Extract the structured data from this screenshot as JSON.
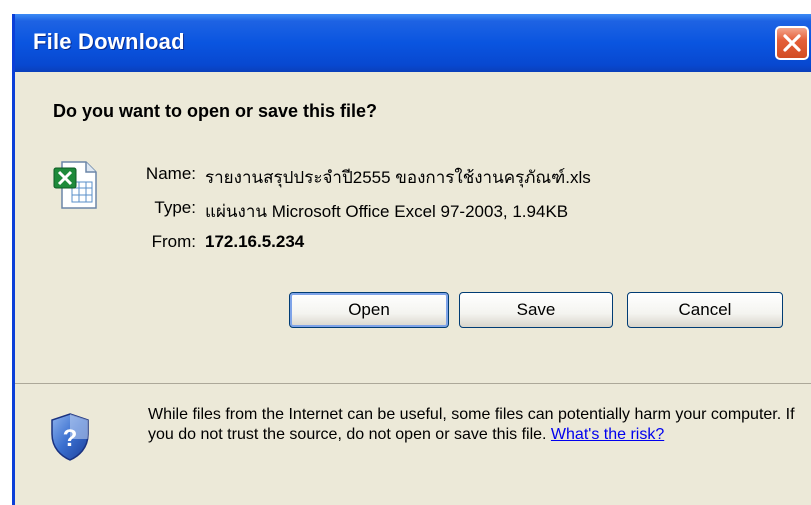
{
  "window": {
    "title": "File Download"
  },
  "prompt": {
    "question": "Do you want to open or save this file?"
  },
  "file": {
    "icon": "excel-file-icon",
    "name_label": "Name:",
    "name_value": "รายงานสรุปประจำปี2555 ของการใช้งานครุภัณฑ์.xls",
    "type_label": "Type:",
    "type_value": "แผ่นงาน Microsoft Office Excel 97-2003, 1.94KB",
    "from_label": "From:",
    "from_value": "172.16.5.234"
  },
  "buttons": {
    "open": "Open",
    "save": "Save",
    "cancel": "Cancel"
  },
  "warning": {
    "text": "While files from the Internet can be useful, some files can potentially harm your computer. If you do not trust the source, do not open or save this file.",
    "link": "What's the risk?",
    "icon": "shield-question-icon"
  },
  "colors": {
    "titlebar": "#0a55e0",
    "dialog_bg": "#ece9d8",
    "close_button": "#d24c22",
    "link": "#0000ee"
  }
}
